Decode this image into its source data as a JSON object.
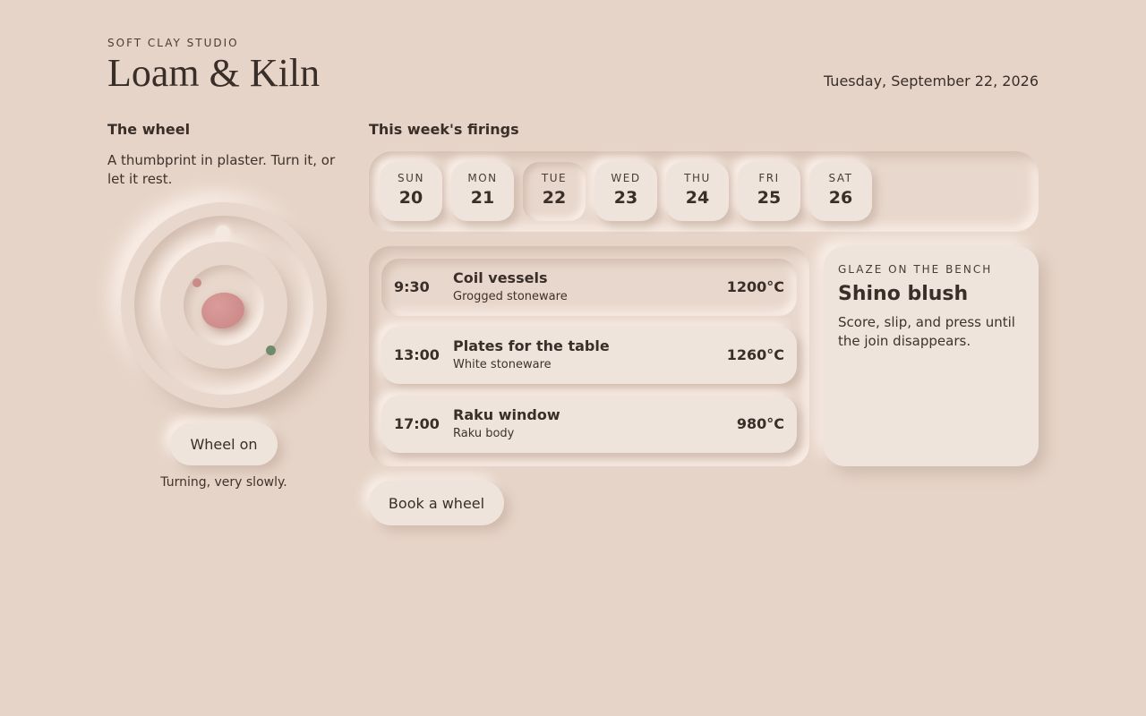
{
  "header": {
    "eyebrow": "SOFT CLAY STUDIO",
    "brand": "Loam & Kiln",
    "date": "Tuesday, September 22, 2026"
  },
  "wheel": {
    "title": "The wheel",
    "description": "A thumbprint in plaster. Turn it, or let it rest.",
    "button_label": "Wheel on",
    "status": "Turning, very slowly."
  },
  "firings": {
    "title": "This week's firings",
    "days": [
      {
        "name": "SUN",
        "num": "20",
        "active": false
      },
      {
        "name": "MON",
        "num": "21",
        "active": false
      },
      {
        "name": "TUE",
        "num": "22",
        "active": true
      },
      {
        "name": "WED",
        "num": "23",
        "active": false
      },
      {
        "name": "THU",
        "num": "24",
        "active": false
      },
      {
        "name": "FRI",
        "num": "25",
        "active": false
      },
      {
        "name": "SAT",
        "num": "26",
        "active": false
      }
    ],
    "schedule": [
      {
        "time": "9:30",
        "title": "Coil vessels",
        "sub": "Grogged stoneware",
        "temp": "1200°C",
        "active": true
      },
      {
        "time": "13:00",
        "title": "Plates for the table",
        "sub": "White stoneware",
        "temp": "1260°C",
        "active": false
      },
      {
        "time": "17:00",
        "title": "Raku window",
        "sub": "Raku body",
        "temp": "980°C",
        "active": false
      }
    ]
  },
  "glaze": {
    "eyebrow": "GLAZE ON THE BENCH",
    "title": "Shino blush",
    "description": "Score, slip, and press until the join disappears."
  },
  "book_button_label": "Book a wheel",
  "colors": {
    "background": "#e6d4c8",
    "clay": "#cc8a87",
    "sage_dot": "#6f8b6e",
    "text": "#3a2e28"
  }
}
